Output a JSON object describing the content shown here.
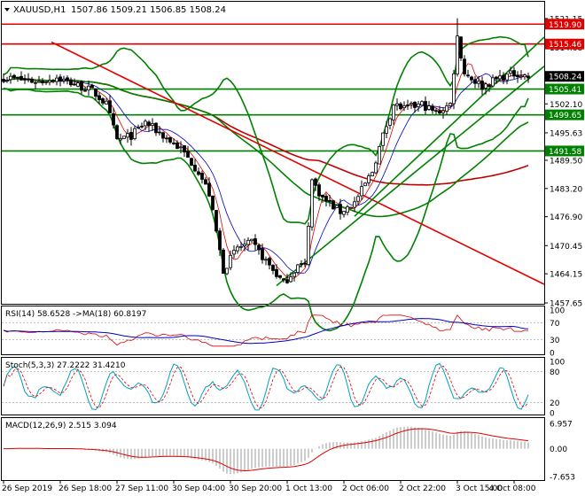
{
  "header": {
    "symbol": "XAUUSD,H1",
    "ohlc": "1507.86 1509.21 1506.85 1508.24"
  },
  "price_axis": {
    "ticks": [
      "1521.15",
      "1514.68",
      "1508.24",
      "1502.10",
      "1495.63",
      "1489.50",
      "1483.20",
      "1476.90",
      "1470.45",
      "1464.15",
      "1457.65"
    ],
    "current_price": "1508.24",
    "levels": [
      {
        "value": 1519.9,
        "label": "1519.90",
        "color": "#e00000"
      },
      {
        "value": 1515.46,
        "label": "1515.46",
        "color": "#e00000"
      },
      {
        "value": 1505.41,
        "label": "1505.41",
        "color": "#008000"
      },
      {
        "value": 1499.65,
        "label": "1499.65",
        "color": "#008000"
      },
      {
        "value": 1491.58,
        "label": "1491.58",
        "color": "#008000"
      }
    ]
  },
  "time_axis": [
    "26 Sep 2019",
    "26 Sep 18:00",
    "27 Sep 11:00",
    "30 Sep 04:00",
    "30 Sep 20:00",
    "1 Oct 13:00",
    "2 Oct 06:00",
    "2 Oct 22:00",
    "3 Oct 15:00",
    "4 Oct 08:00"
  ],
  "rsi": {
    "label": "RSI(14) 58.6528  ->MA(18) 60.8197",
    "ticks": [
      "100",
      "70",
      "30",
      "0"
    ]
  },
  "stoch": {
    "label": "Stoch(5,3,3) 27.2222 31.4210",
    "ticks": [
      "100",
      "80",
      "20",
      "0"
    ]
  },
  "macd": {
    "label": "MACD(12,26,9) 2.515 3.094",
    "ticks": [
      "6.957",
      "0.00",
      "-7.653"
    ]
  },
  "colors": {
    "up": "#000000",
    "down": "#000000",
    "bollinger": "#008000",
    "trend": "#e00000",
    "rsi": "#e00000",
    "rsi_ma": "#0000c0",
    "stoch_main": "#00a0c0",
    "stoch_signal": "#e00000"
  },
  "chart_data": {
    "type": "candlestick",
    "title": "XAUUSD,H1",
    "ylim": [
      1457.65,
      1524.5
    ],
    "series": [
      {
        "name": "XAUUSD,H1",
        "values": "OHLC candles (H1), ~149 bars, generated from the visible price path"
      }
    ]
  }
}
